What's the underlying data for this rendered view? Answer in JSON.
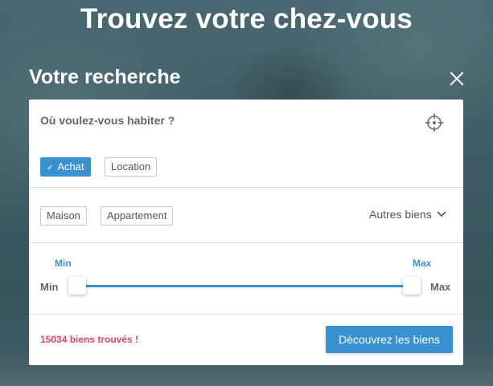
{
  "hero": {
    "title": "Trouvez votre chez-vous"
  },
  "panel": {
    "title": "Votre recherche"
  },
  "search": {
    "location_placeholder": "Où voulez-vous habiter ?",
    "location_value": ""
  },
  "transaction": {
    "options": [
      {
        "label": "Achat",
        "selected": true
      },
      {
        "label": "Location",
        "selected": false
      }
    ]
  },
  "property_types": {
    "options": [
      {
        "label": "Maison"
      },
      {
        "label": "Appartement"
      }
    ],
    "more_label": "Autres biens"
  },
  "price_range": {
    "min_value_label": "Min",
    "max_value_label": "Max",
    "min_side_label": "Min",
    "max_side_label": "Max",
    "min_fraction": 0.0,
    "max_fraction": 1.0
  },
  "results": {
    "count_text": "15034 biens trouvés !",
    "cta_label": "Découvrez les biens"
  },
  "colors": {
    "accent": "#3a91d0",
    "results": "#e6446a",
    "card": "#ffffff"
  }
}
